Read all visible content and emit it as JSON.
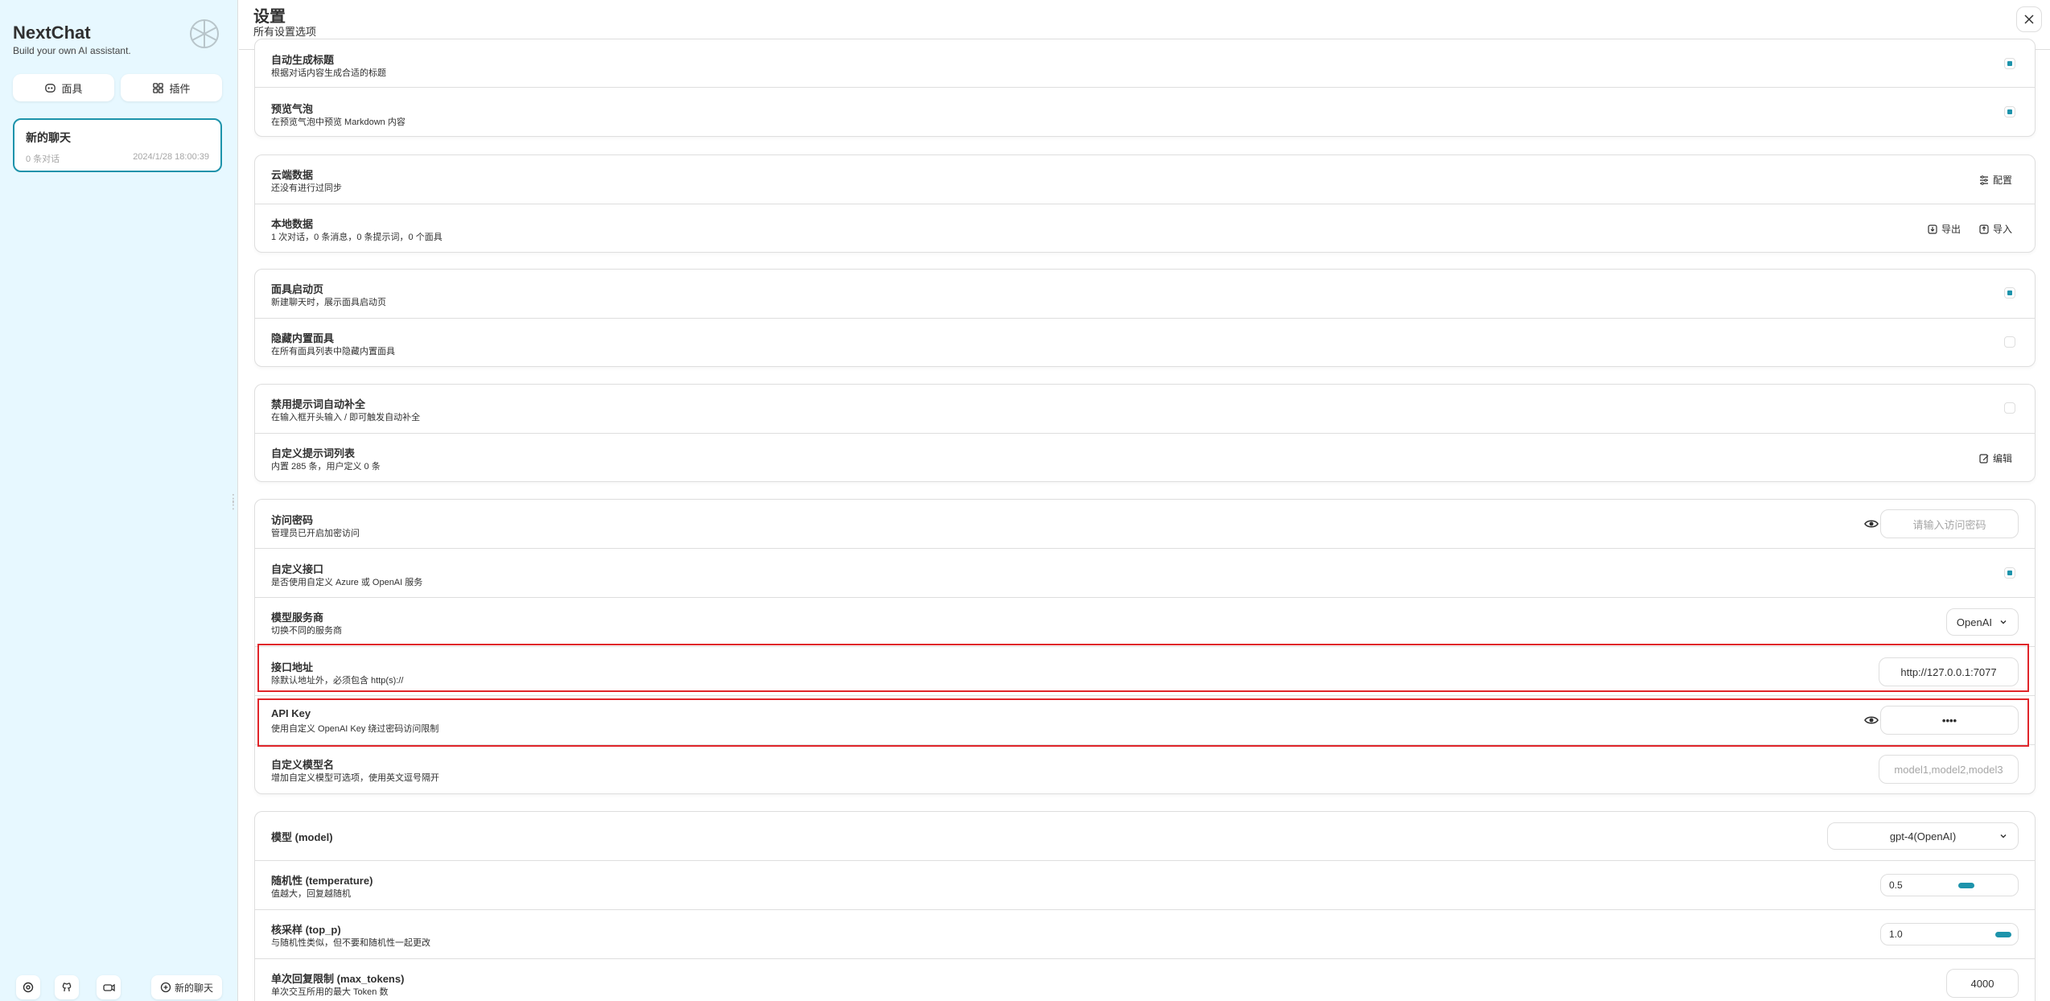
{
  "sidebar": {
    "app_name": "NextChat",
    "tagline": "Build your own AI assistant.",
    "mask_button": "面具",
    "plugin_button": "插件",
    "chat": {
      "title": "新的聊天",
      "count": "0 条对话",
      "date": "2024/1/28 18:00:39"
    },
    "new_chat": "新的聊天"
  },
  "header": {
    "title": "设置",
    "subtitle": "所有设置选项"
  },
  "groups": {
    "g1": {
      "auto_title": {
        "title": "自动生成标题",
        "sub": "根据对话内容生成合适的标题",
        "checked": true
      },
      "preview_bubble": {
        "title": "预览气泡",
        "sub": "在预览气泡中预览 Markdown 内容",
        "checked": true
      }
    },
    "g2": {
      "cloud": {
        "title": "云端数据",
        "sub": "还没有进行过同步",
        "action": "配置"
      },
      "local": {
        "title": "本地数据",
        "sub": "1 次对话，0 条消息，0 条提示词，0 个面具",
        "export": "导出",
        "import": "导入"
      }
    },
    "g3": {
      "mask_launch": {
        "title": "面具启动页",
        "sub": "新建聊天时，展示面具启动页",
        "checked": true
      },
      "hide_masks": {
        "title": "隐藏内置面具",
        "sub": "在所有面具列表中隐藏内置面具",
        "checked": false
      }
    },
    "g4": {
      "disable_prompt": {
        "title": "禁用提示词自动补全",
        "sub": "在输入框开头输入 / 即可触发自动补全",
        "checked": false
      },
      "custom_prompts": {
        "title": "自定义提示词列表",
        "sub": "内置 285 条，用户定义 0 条",
        "action": "编辑"
      }
    },
    "g5": {
      "access_code": {
        "title": "访问密码",
        "sub": "管理员已开启加密访问",
        "placeholder": "请输入访问密码"
      },
      "custom_endpoint": {
        "title": "自定义接口",
        "sub": "是否使用自定义 Azure 或 OpenAI 服务",
        "checked": true
      },
      "provider": {
        "title": "模型服务商",
        "sub": "切换不同的服务商",
        "value": "OpenAI"
      },
      "endpoint": {
        "title": "接口地址",
        "sub": "除默认地址外，必须包含 http(s)://",
        "value": "http://127.0.0.1:7077"
      },
      "api_key": {
        "title": "API Key",
        "sub": "使用自定义 OpenAI Key 绕过密码访问限制",
        "value": "••••"
      },
      "custom_models": {
        "title": "自定义模型名",
        "sub": "增加自定义模型可选项，使用英文逗号隔开",
        "placeholder": "model1,model2,model3"
      }
    },
    "g6": {
      "model": {
        "title": "模型 (model)",
        "value": "gpt-4(OpenAI)"
      },
      "temperature": {
        "title": "随机性 (temperature)",
        "sub": "值越大，回复越随机",
        "value": "0.5"
      },
      "top_p": {
        "title": "核采样 (top_p)",
        "sub": "与随机性类似，但不要和随机性一起更改",
        "value": "1.0"
      },
      "max_tokens": {
        "title": "单次回复限制 (max_tokens)",
        "sub": "单次交互所用的最大 Token 数",
        "value": "4000"
      }
    }
  },
  "colors": {
    "accent": "#1d93ab",
    "sidebar_bg": "#e7f8ff",
    "highlight": "#e0252a"
  }
}
